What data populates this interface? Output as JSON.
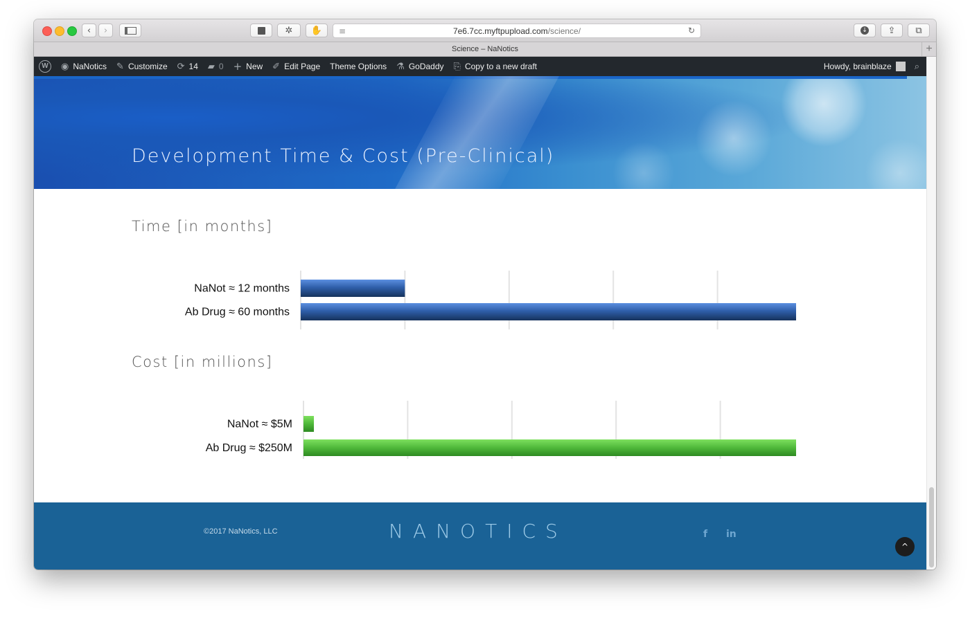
{
  "browser": {
    "url_domain": "7e6.7cc.myftpupload.com",
    "url_path": "/science/",
    "tab_title": "Science – NaNotics",
    "new_tab_label": "+"
  },
  "admin_bar": {
    "site_name": "NaNotics",
    "customize": "Customize",
    "updates_count": "14",
    "comments_count": "0",
    "new": "New",
    "edit_page": "Edit Page",
    "theme_options": "Theme Options",
    "godaddy": "GoDaddy",
    "copy_draft": "Copy to a new draft",
    "howdy": "Howdy, brainblaze"
  },
  "hero": {
    "title": "Development Time & Cost (Pre-Clinical)"
  },
  "sections": {
    "time_title": "Time [in months]",
    "cost_title": "Cost [in millions]"
  },
  "chart_data": [
    {
      "type": "bar",
      "orientation": "horizontal",
      "categories": [
        "NaNot ≈ 12 months",
        "Ab Drug ≈ 60 months"
      ],
      "values": [
        12,
        60
      ],
      "ticks": [
        "0",
        "12",
        "24",
        "36",
        "48",
        "60"
      ],
      "xlim": [
        0,
        60
      ],
      "grid": true,
      "color": "#2f5faa"
    },
    {
      "type": "bar",
      "orientation": "horizontal",
      "categories": [
        "NaNot ≈ $5M",
        "Ab Drug ≈ $250M"
      ],
      "values": [
        5,
        250
      ],
      "ticks": [
        "0",
        "50",
        "100",
        "150",
        "200",
        "250"
      ],
      "xlim": [
        0,
        250
      ],
      "grid": true,
      "color": "#4fb83a"
    }
  ],
  "footer": {
    "copyright": "©2017 NaNotics, LLC",
    "logo": "NANOTICS",
    "facebook": "f",
    "linkedin": "in",
    "to_top": "^"
  }
}
